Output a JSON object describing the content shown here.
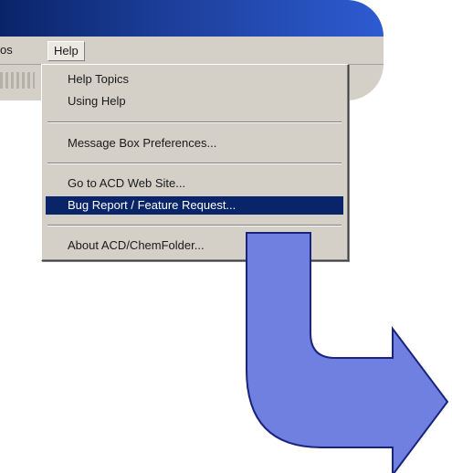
{
  "menubar": {
    "prev_item_fragment": "os",
    "help_label": "Help"
  },
  "help_menu": {
    "items": [
      {
        "label": "Help Topics"
      },
      {
        "label": "Using Help"
      },
      {
        "label": "Message Box Preferences..."
      },
      {
        "label": "Go to ACD Web Site..."
      },
      {
        "label": "Bug Report / Feature Request...",
        "selected": true
      },
      {
        "label": "About ACD/ChemFolder..."
      }
    ]
  },
  "colors": {
    "titlebar": "#0a246a",
    "menu_bg": "#d4d0c8",
    "selection": "#0a246a",
    "arrow_fill": "#7080e0",
    "arrow_stroke": "#1a237e"
  },
  "icons": [
    "arrow-icon"
  ]
}
